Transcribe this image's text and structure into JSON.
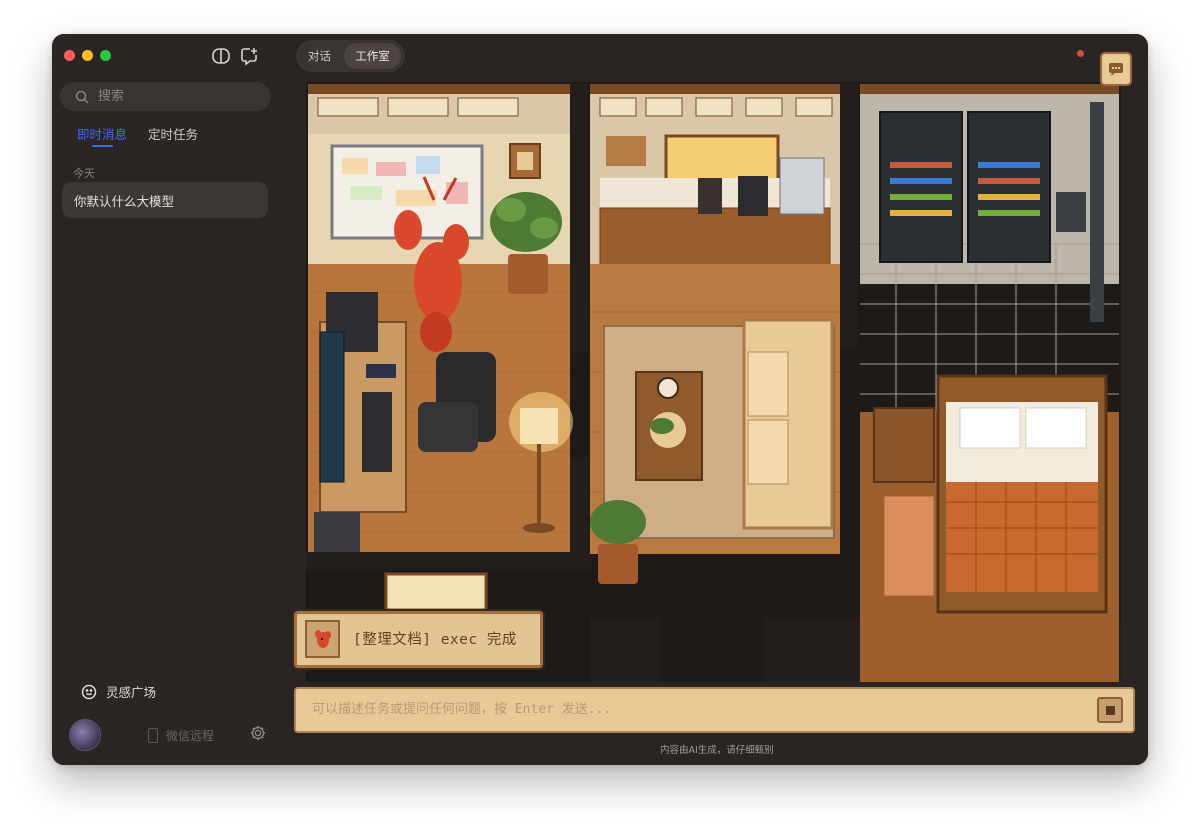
{
  "sidebar": {
    "search_placeholder": "搜索",
    "tabs": [
      {
        "label": "即时消息",
        "active": true
      },
      {
        "label": "定时任务",
        "active": false
      }
    ],
    "section_label": "今天",
    "chats": [
      {
        "title": "你默认什么大模型"
      }
    ],
    "inspiration_label": "灵感广场",
    "wechat_label": "微信远程"
  },
  "main": {
    "segments": [
      {
        "label": "对话",
        "active": false
      },
      {
        "label": "工作室",
        "active": true
      }
    ],
    "toast_text": "[整理文档] exec 完成",
    "input_placeholder": "可以描述任务或提问任何问题，按 Enter 发送...",
    "disclaimer": "内容由AI生成，请仔细甄别"
  },
  "colors": {
    "accent": "#3d6bff",
    "window_bg": "#2a2422",
    "pixel_panel": "#e7c998",
    "pixel_border": "#a0703f"
  },
  "icons": {
    "sidebar_toggle": "sidebar-toggle-icon",
    "new_chat": "new-chat-icon",
    "search": "search-icon",
    "inspiration": "smile-face-icon",
    "settings": "gear-icon",
    "chat_bubble": "chat-bubble-icon",
    "notebook": "notebook-icon",
    "lobster": "lobster-icon",
    "stop": "stop-icon"
  }
}
